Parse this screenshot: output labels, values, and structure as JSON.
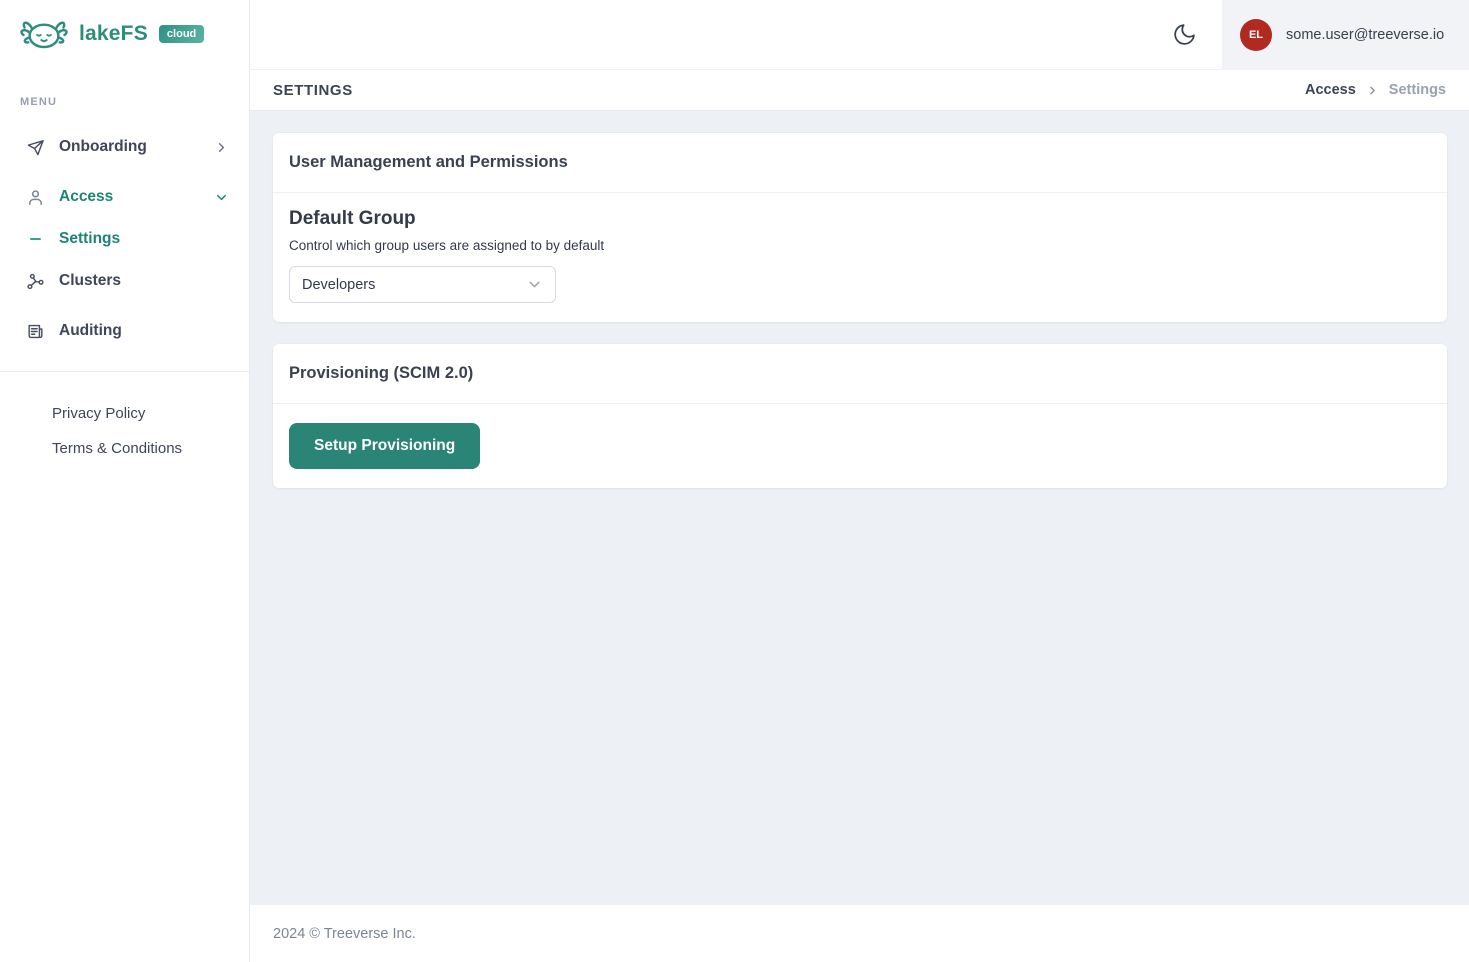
{
  "brand": {
    "name": "lakeFS",
    "badge": "cloud"
  },
  "sidebar": {
    "menu_label": "MENU",
    "items": [
      {
        "label": "Onboarding",
        "icon": "paper-plane-icon",
        "active": false
      },
      {
        "label": "Access",
        "icon": "user-icon",
        "active": true
      },
      {
        "label": "Settings",
        "icon": "dash-icon",
        "active": true
      },
      {
        "label": "Clusters",
        "icon": "network-icon",
        "active": false
      },
      {
        "label": "Auditing",
        "icon": "newspaper-icon",
        "active": false
      }
    ],
    "links": [
      "Privacy Policy",
      "Terms & Conditions"
    ]
  },
  "topbar": {
    "theme_toggle": "moon-icon",
    "user_initials": "EL",
    "user_email": "some.user@treeverse.io"
  },
  "header": {
    "title": "SETTINGS",
    "breadcrumb": {
      "parent": "Access",
      "current": "Settings"
    }
  },
  "main": {
    "user_management_card": {
      "title": "User Management and Permissions",
      "default_group": {
        "heading": "Default Group",
        "description": "Control which group users are assigned to by default",
        "selected_option": "Developers"
      }
    },
    "provisioning_card": {
      "title": "Provisioning (SCIM 2.0)",
      "setup_button": "Setup Provisioning"
    }
  },
  "footer": {
    "copyright": "2024 © Treeverse Inc."
  },
  "colors": {
    "accent_teal": "#2b8577",
    "brand_teal": "#2c8c7d",
    "avatar_red": "#b02a21",
    "content_bg": "#edf1f5",
    "panel_gray": "#f1f3f6"
  }
}
